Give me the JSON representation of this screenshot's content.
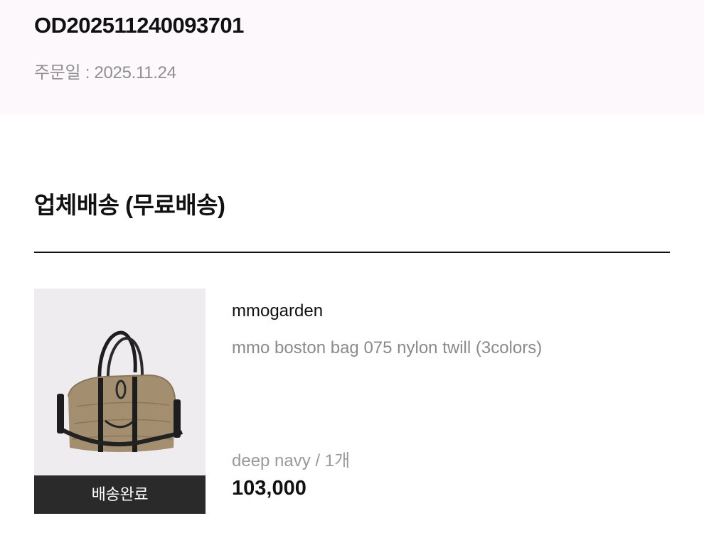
{
  "order": {
    "number": "OD202511240093701",
    "date_label": "주문일 : 2025.11.24"
  },
  "shipping_section": {
    "title": "업체배송 (무료배송)"
  },
  "item": {
    "status": "배송완료",
    "brand": "mmogarden",
    "name": "mmo boston bag 075 nylon twill (3colors)",
    "option": "deep navy / 1개",
    "price": "103,000",
    "image_icon": "boston-bag-image"
  },
  "colors": {
    "header_bg": "#fdf8fb",
    "status_bg": "#2a2a2a",
    "muted_text": "#8a8a8a"
  }
}
